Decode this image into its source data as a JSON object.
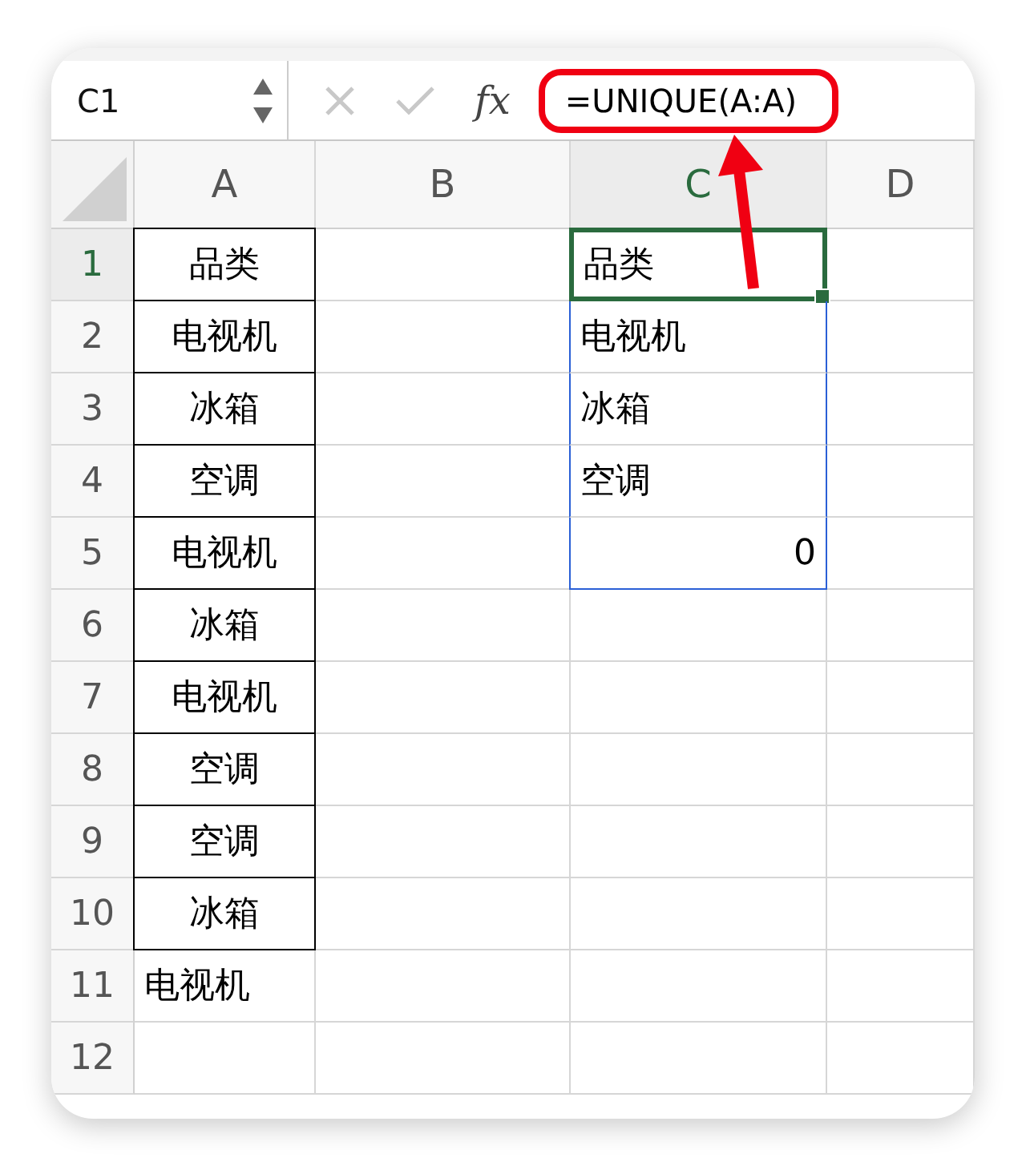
{
  "name_box": "C1",
  "fx_label": "fx",
  "formula": "=UNIQUE(A:A)",
  "columns": [
    {
      "label": "A",
      "selected": false
    },
    {
      "label": "B",
      "selected": false
    },
    {
      "label": "C",
      "selected": true
    },
    {
      "label": "D",
      "selected": false
    }
  ],
  "rows": [
    {
      "label": "1",
      "selected": true,
      "col_a": {
        "text": "品类",
        "kind": "boxed"
      },
      "col_c": {
        "text": "品类",
        "kind": "text",
        "selected": true
      }
    },
    {
      "label": "2",
      "selected": false,
      "col_a": {
        "text": "电视机",
        "kind": "boxed"
      },
      "col_c": {
        "text": "电视机",
        "kind": "text",
        "selected": false,
        "spill": true
      }
    },
    {
      "label": "3",
      "selected": false,
      "col_a": {
        "text": "冰箱",
        "kind": "boxed"
      },
      "col_c": {
        "text": "冰箱",
        "kind": "text",
        "selected": false,
        "spill": true
      }
    },
    {
      "label": "4",
      "selected": false,
      "col_a": {
        "text": "空调",
        "kind": "boxed"
      },
      "col_c": {
        "text": "空调",
        "kind": "text",
        "selected": false,
        "spill": true
      }
    },
    {
      "label": "5",
      "selected": false,
      "col_a": {
        "text": "电视机",
        "kind": "boxed"
      },
      "col_c": {
        "text": "0",
        "kind": "number",
        "selected": false,
        "spill": true
      }
    },
    {
      "label": "6",
      "selected": false,
      "col_a": {
        "text": "冰箱",
        "kind": "boxed"
      }
    },
    {
      "label": "7",
      "selected": false,
      "col_a": {
        "text": "电视机",
        "kind": "boxed"
      }
    },
    {
      "label": "8",
      "selected": false,
      "col_a": {
        "text": "空调",
        "kind": "boxed"
      }
    },
    {
      "label": "9",
      "selected": false,
      "col_a": {
        "text": "空调",
        "kind": "boxed"
      }
    },
    {
      "label": "10",
      "selected": false,
      "col_a": {
        "text": "冰箱",
        "kind": "boxed"
      }
    },
    {
      "label": "11",
      "selected": false,
      "col_a": {
        "text": "电视机",
        "kind": "text"
      }
    },
    {
      "label": "12",
      "selected": false
    }
  ]
}
